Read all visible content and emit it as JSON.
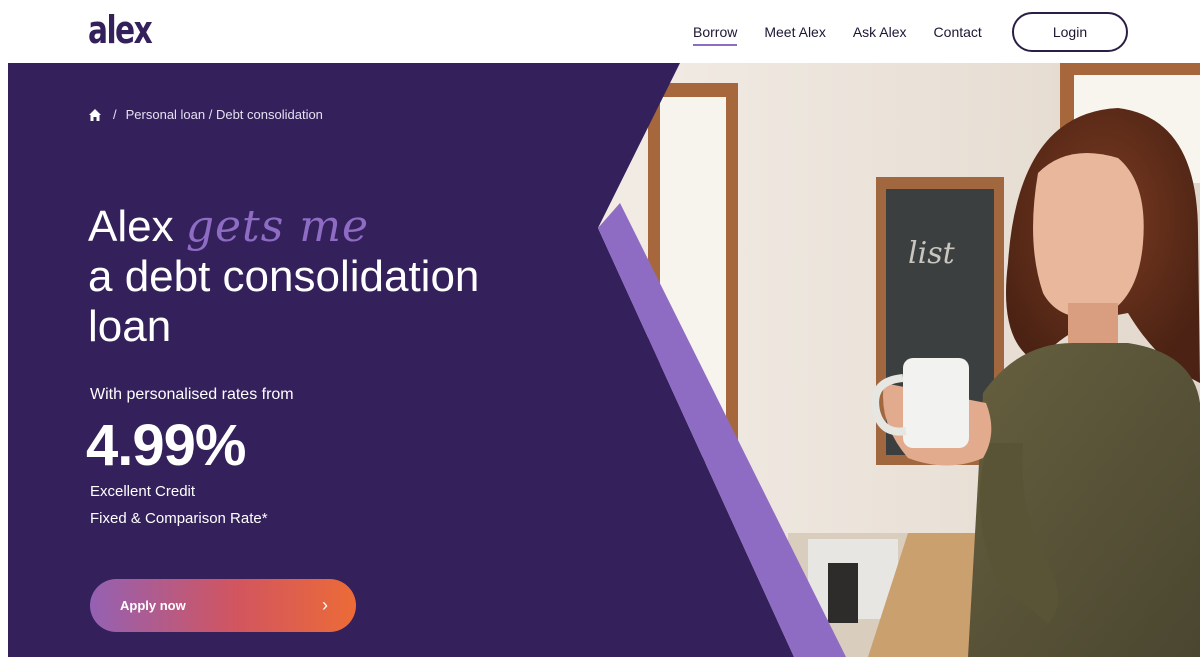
{
  "brand": {
    "logo_text": "alex"
  },
  "nav": {
    "items": [
      {
        "label": "Borrow",
        "active": true
      },
      {
        "label": "Meet Alex",
        "active": false
      },
      {
        "label": "Ask Alex",
        "active": false
      },
      {
        "label": "Contact",
        "active": false
      }
    ],
    "login_label": "Login"
  },
  "breadcrumb": {
    "separator": "/",
    "path": "Personal loan / Debt consolidation"
  },
  "hero": {
    "headline_1": "Alex",
    "headline_script": "gets me",
    "headline_2": "a debt consolidation",
    "headline_3": "loan",
    "subline": "With personalised rates from",
    "rate": "4.99%",
    "rate_label_1": "Excellent Credit",
    "rate_label_2": "Fixed & Comparison Rate*",
    "apply_label": "Apply now",
    "apply_icon": "›"
  },
  "colors": {
    "panel": "#34215c",
    "accent": "#8f6cc4",
    "button_start": "#9461b3",
    "button_end": "#ec6b37"
  }
}
